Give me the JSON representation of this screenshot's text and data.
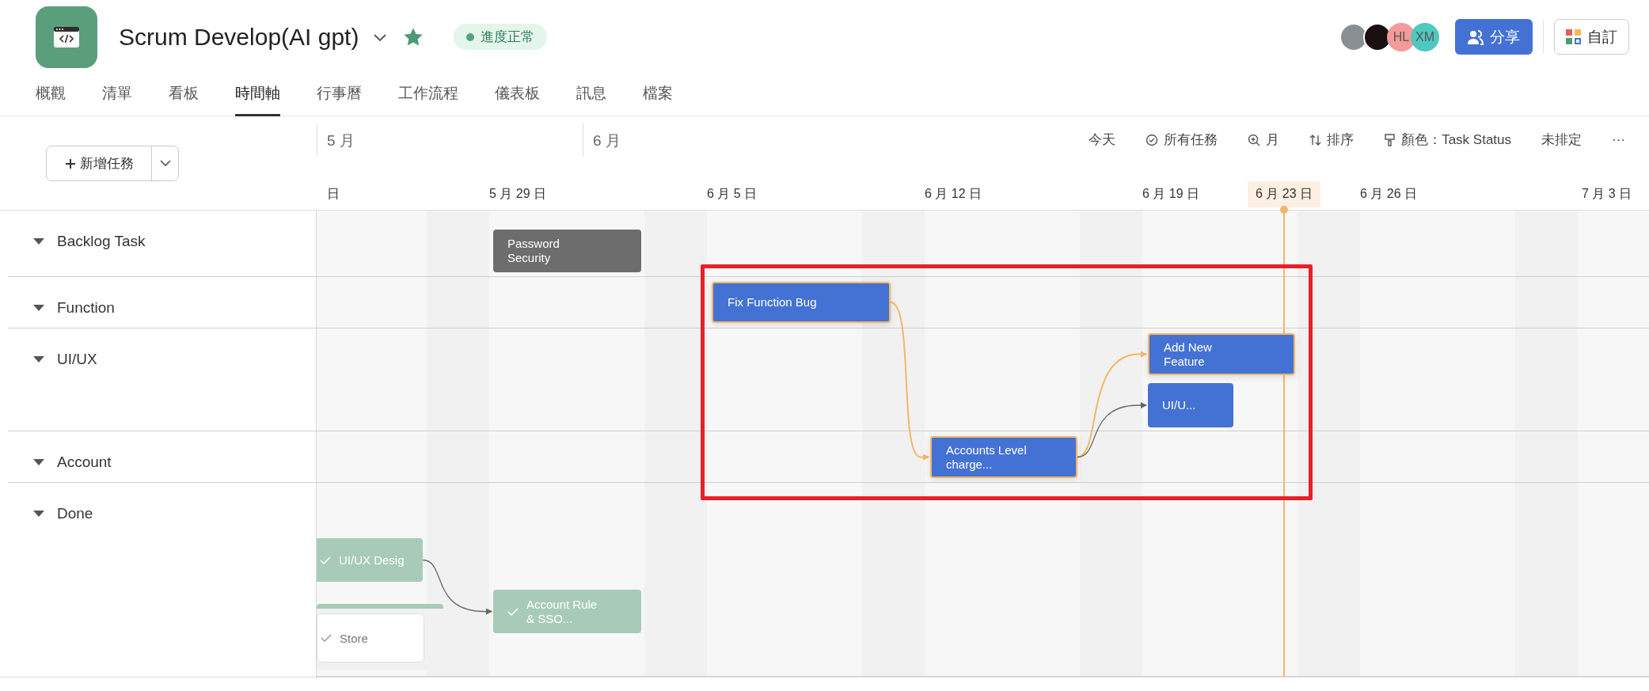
{
  "project": {
    "title": "Scrum Develop(AI gpt)",
    "starred": true,
    "status": "進度正常"
  },
  "tabs": [
    {
      "label": "概觀",
      "selected": false
    },
    {
      "label": "清單",
      "selected": false
    },
    {
      "label": "看板",
      "selected": false
    },
    {
      "label": "時間軸",
      "selected": true
    },
    {
      "label": "行事曆",
      "selected": false
    },
    {
      "label": "工作流程",
      "selected": false
    },
    {
      "label": "儀表板",
      "selected": false
    },
    {
      "label": "訊息",
      "selected": false
    },
    {
      "label": "檔案",
      "selected": false
    }
  ],
  "members": [
    {
      "kind": "photo"
    },
    {
      "kind": "photo"
    },
    {
      "kind": "initials",
      "initials": "HL",
      "color": "#f59a9a"
    },
    {
      "kind": "initials",
      "initials": "XM",
      "color": "#4fc8c0"
    }
  ],
  "share_button": "分享",
  "customize_button": "自訂",
  "add_task_button": "新增任務",
  "months": [
    "5 月",
    "6 月"
  ],
  "toolbar": [
    {
      "kind": "plain",
      "label": "今天"
    },
    {
      "kind": "check",
      "label": "所有任務"
    },
    {
      "kind": "zoom",
      "label": "月"
    },
    {
      "kind": "sort",
      "label": "排序"
    },
    {
      "kind": "color",
      "label": "顏色：Task Status"
    },
    {
      "kind": "plain",
      "label": "未排定"
    },
    {
      "kind": "plain",
      "label": "···"
    }
  ],
  "dates": [
    {
      "label": "日",
      "today": false
    },
    {
      "label": "5 月 29 日",
      "today": false
    },
    {
      "label": "6 月 5 日",
      "today": false
    },
    {
      "label": "6 月 12 日",
      "today": false
    },
    {
      "label": "6 月 19 日",
      "today": false
    },
    {
      "label": "6 月 23 日",
      "today": true
    },
    {
      "label": "6 月 26 日",
      "today": false
    },
    {
      "label": "7 月 3 日",
      "today": false
    }
  ],
  "groups": [
    {
      "label": "Backlog Task",
      "expanded": true
    },
    {
      "label": "Function",
      "expanded": true
    },
    {
      "label": "UI/UX",
      "expanded": true
    },
    {
      "label": "Account",
      "expanded": true
    },
    {
      "label": "Done",
      "expanded": true
    }
  ],
  "tasks": [
    {
      "name": "Password Security",
      "kind": "backlog",
      "highlighted": false
    },
    {
      "name": "Fix Function Bug",
      "kind": "active",
      "highlighted": true
    },
    {
      "name": "Add New Feature",
      "kind": "active",
      "highlighted": true
    },
    {
      "name": "UI/U...",
      "kind": "active",
      "highlighted": false
    },
    {
      "name": "Accounts Level charge...",
      "kind": "active",
      "highlighted": true
    },
    {
      "name": "UI/UX Desig",
      "kind": "done",
      "highlighted": false
    },
    {
      "name": "Store",
      "kind": "card",
      "highlighted": false
    },
    {
      "name": "Account Rule & SSO...",
      "kind": "done",
      "highlighted": false
    }
  ],
  "dependencies": [
    {
      "highlighted": true
    },
    {
      "highlighted": true
    },
    {
      "highlighted": false
    },
    {
      "highlighted": false
    }
  ],
  "annotation_box": true
}
